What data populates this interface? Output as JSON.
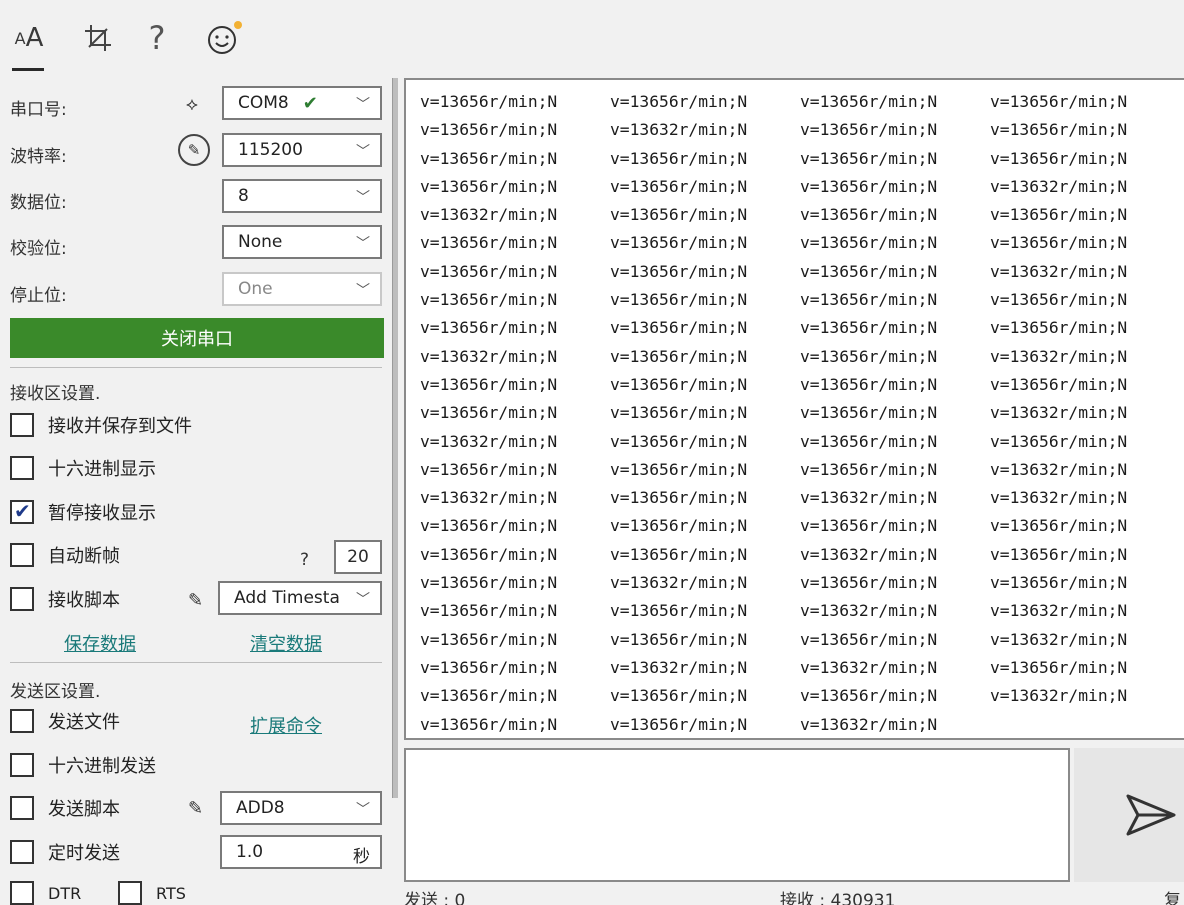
{
  "toolbar": {
    "font_icon": "AA",
    "crop_icon": "crop-icon",
    "help_icon": "?",
    "smile_icon": "smile-icon"
  },
  "serial": {
    "port_label": "串口号:",
    "port_value": "COM8",
    "baud_label": "波特率:",
    "baud_value": "115200",
    "databits_label": "数据位:",
    "databits_value": "8",
    "parity_label": "校验位:",
    "parity_value": "None",
    "stopbits_label": "停止位:",
    "stopbits_value": "One",
    "close_button": "关闭串口"
  },
  "receive_settings": {
    "title": "接收区设置.",
    "save_to_file": "接收并保存到文件",
    "hex_display": "十六进制显示",
    "pause_display": "暂停接收显示",
    "auto_break": "自动断帧",
    "auto_break_help": "?",
    "auto_break_value": "20",
    "recv_script": "接收脚本",
    "recv_script_value": "Add Timesta",
    "save_data": "保存数据",
    "clear_data": "清空数据"
  },
  "send_settings": {
    "title": "发送区设置.",
    "send_file": "发送文件",
    "ext_command": "扩展命令",
    "hex_send": "十六进制发送",
    "send_script": "发送脚本",
    "send_script_value": "ADD8",
    "timed_send": "定时发送",
    "timed_value": "1.0",
    "timed_unit": "秒",
    "dtr": "DTR",
    "rts": "RTS"
  },
  "receive_rows": [
    [
      "v=13656r/min;N",
      "v=13656r/min;N",
      "v=13656r/min;N",
      "v=13656r/min;N"
    ],
    [
      "v=13656r/min;N",
      "v=13632r/min;N",
      "v=13656r/min;N",
      "v=13656r/min;N"
    ],
    [
      "v=13656r/min;N",
      "v=13656r/min;N",
      "v=13656r/min;N",
      "v=13656r/min;N"
    ],
    [
      "v=13656r/min;N",
      "v=13656r/min;N",
      "v=13656r/min;N",
      "v=13632r/min;N"
    ],
    [
      "v=13632r/min;N",
      "v=13656r/min;N",
      "v=13656r/min;N",
      "v=13656r/min;N"
    ],
    [
      "v=13656r/min;N",
      "v=13656r/min;N",
      "v=13656r/min;N",
      "v=13656r/min;N"
    ],
    [
      "v=13656r/min;N",
      "v=13656r/min;N",
      "v=13656r/min;N",
      "v=13632r/min;N"
    ],
    [
      "v=13656r/min;N",
      "v=13656r/min;N",
      "v=13656r/min;N",
      "v=13656r/min;N"
    ],
    [
      "v=13656r/min;N",
      "v=13656r/min;N",
      "v=13656r/min;N",
      "v=13656r/min;N"
    ],
    [
      "v=13632r/min;N",
      "v=13656r/min;N",
      "v=13656r/min;N",
      "v=13632r/min;N"
    ],
    [
      "v=13656r/min;N",
      "v=13656r/min;N",
      "v=13656r/min;N",
      "v=13656r/min;N"
    ],
    [
      "v=13656r/min;N",
      "v=13656r/min;N",
      "v=13656r/min;N",
      "v=13632r/min;N"
    ],
    [
      "v=13632r/min;N",
      "v=13656r/min;N",
      "v=13656r/min;N",
      "v=13656r/min;N"
    ],
    [
      "v=13656r/min;N",
      "v=13656r/min;N",
      "v=13656r/min;N",
      "v=13632r/min;N"
    ],
    [
      "v=13632r/min;N",
      "v=13656r/min;N",
      "v=13632r/min;N",
      "v=13632r/min;N"
    ],
    [
      "v=13656r/min;N",
      "v=13656r/min;N",
      "v=13656r/min;N",
      "v=13656r/min;N"
    ],
    [
      "v=13656r/min;N",
      "v=13656r/min;N",
      "v=13632r/min;N",
      "v=13656r/min;N"
    ],
    [
      "v=13656r/min;N",
      "v=13632r/min;N",
      "v=13656r/min;N",
      "v=13656r/min;N"
    ],
    [
      "v=13656r/min;N",
      "v=13656r/min;N",
      "v=13632r/min;N",
      "v=13632r/min;N"
    ],
    [
      "v=13656r/min;N",
      "v=13656r/min;N",
      "v=13656r/min;N",
      "v=13632r/min;N"
    ],
    [
      "v=13656r/min;N",
      "v=13632r/min;N",
      "v=13632r/min;N",
      "v=13656r/min;N"
    ],
    [
      "v=13656r/min;N",
      "v=13656r/min;N",
      "v=13656r/min;N",
      "v=13632r/min;N"
    ],
    [
      "v=13656r/min;N",
      "v=13656r/min;N",
      "v=13632r/min;N",
      ""
    ]
  ],
  "status": {
    "sent": "发送 : 0",
    "received": "接收 : 430931",
    "reset": "复"
  },
  "colors": {
    "accent_green": "#3a8a2a",
    "link": "#1a7a7a"
  }
}
